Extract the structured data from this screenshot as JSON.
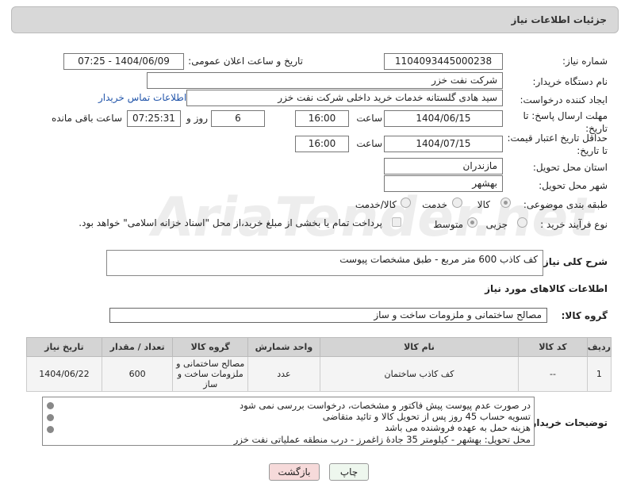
{
  "header": {
    "title": "جزئیات اطلاعات نیاز"
  },
  "form": {
    "need_number_label": "شماره نیاز:",
    "need_number": "1104093445000238",
    "announce_label": "تاریخ و ساعت اعلان عمومی:",
    "announce_value": "1404/06/09 - 07:25",
    "buyer_label": "نام دستگاه خریدار:",
    "buyer_value": "شرکت نفت خزر",
    "creator_label": "ایجاد کننده درخواست:",
    "creator_value": "سید هادی گلستانه خدمات خرید داخلی شرکت نفت خزر",
    "contact_link": "اطلاعات تماس خریدار",
    "deadline_label": "مهلت ارسال پاسخ: تا تاریخ:",
    "deadline_date": "1404/06/15",
    "time_label": "ساعت",
    "deadline_time": "16:00",
    "days_value": "6",
    "days_label": "روز و",
    "remaining_time": "07:25:31",
    "remaining_label": "ساعت باقی مانده",
    "price_validity_label": "حداقل تاریخ اعتبار قیمت: تا تاریخ:",
    "price_date": "1404/07/15",
    "price_time_label": "ساعت",
    "price_time": "16:00",
    "province_label": "استان محل تحویل:",
    "province_value": "مازندران",
    "city_label": "شهر محل تحویل:",
    "city_value": "بهشهر",
    "category_label": "طبقه بندی موضوعی:",
    "category_options": [
      "کالا",
      "خدمت",
      "کالا/خدمت"
    ],
    "category_selected": "کالا",
    "process_label": "نوع فرآیند خرید :",
    "process_options": [
      "جزیی",
      "متوسط"
    ],
    "process_selected": "متوسط",
    "payment_note": "پرداخت تمام یا بخشی از مبلغ خرید،از محل \"اسناد خزانه اسلامی\" خواهد بود."
  },
  "description": {
    "label": "شرح کلی نیاز:",
    "value": "کف کاذب 600 متر مربع - طبق مشخصات پیوست"
  },
  "goods": {
    "section_title": "اطلاعات کالاهای مورد نیاز",
    "group_label": "گروه کالا:",
    "group_value": "مصالح ساختمانی و ملزومات ساخت و ساز"
  },
  "table": {
    "headers": [
      "ردیف",
      "کد کالا",
      "نام کالا",
      "واحد شمارش",
      "گروه کالا",
      "تعداد / مقدار",
      "تاریخ نیاز"
    ],
    "rows": [
      [
        "1",
        "--",
        "کف کاذب ساختمان",
        "عدد",
        "مصالح ساختمانی و ملزومات ساخت و ساز",
        "600",
        "1404/06/22"
      ]
    ]
  },
  "notes": {
    "label": "توضیحات خریدار:",
    "lines": [
      "در صورت عدم پیوست پیش فاکتور و مشخصات، درخواست بررسی نمی شود",
      "تسویه حساب 45 روز پس از تحویل کالا و تائید متقاضی",
      "هزینه حمل به عهده فروشنده می باشد",
      "محل تحویل: بهشهر - کیلومتر 35 جادۀ زاغمرز - درب منطقه عملیاتی نفت خزر"
    ]
  },
  "buttons": {
    "print": "چاپ",
    "back": "بازگشت"
  },
  "watermark": "AriaTender.net",
  "colors": {
    "panel": "#d8d8d8",
    "table_header": "#d4d4d4",
    "back_button": "#f6dada",
    "print_button": "#e8f4e8",
    "link": "#2255aa"
  }
}
